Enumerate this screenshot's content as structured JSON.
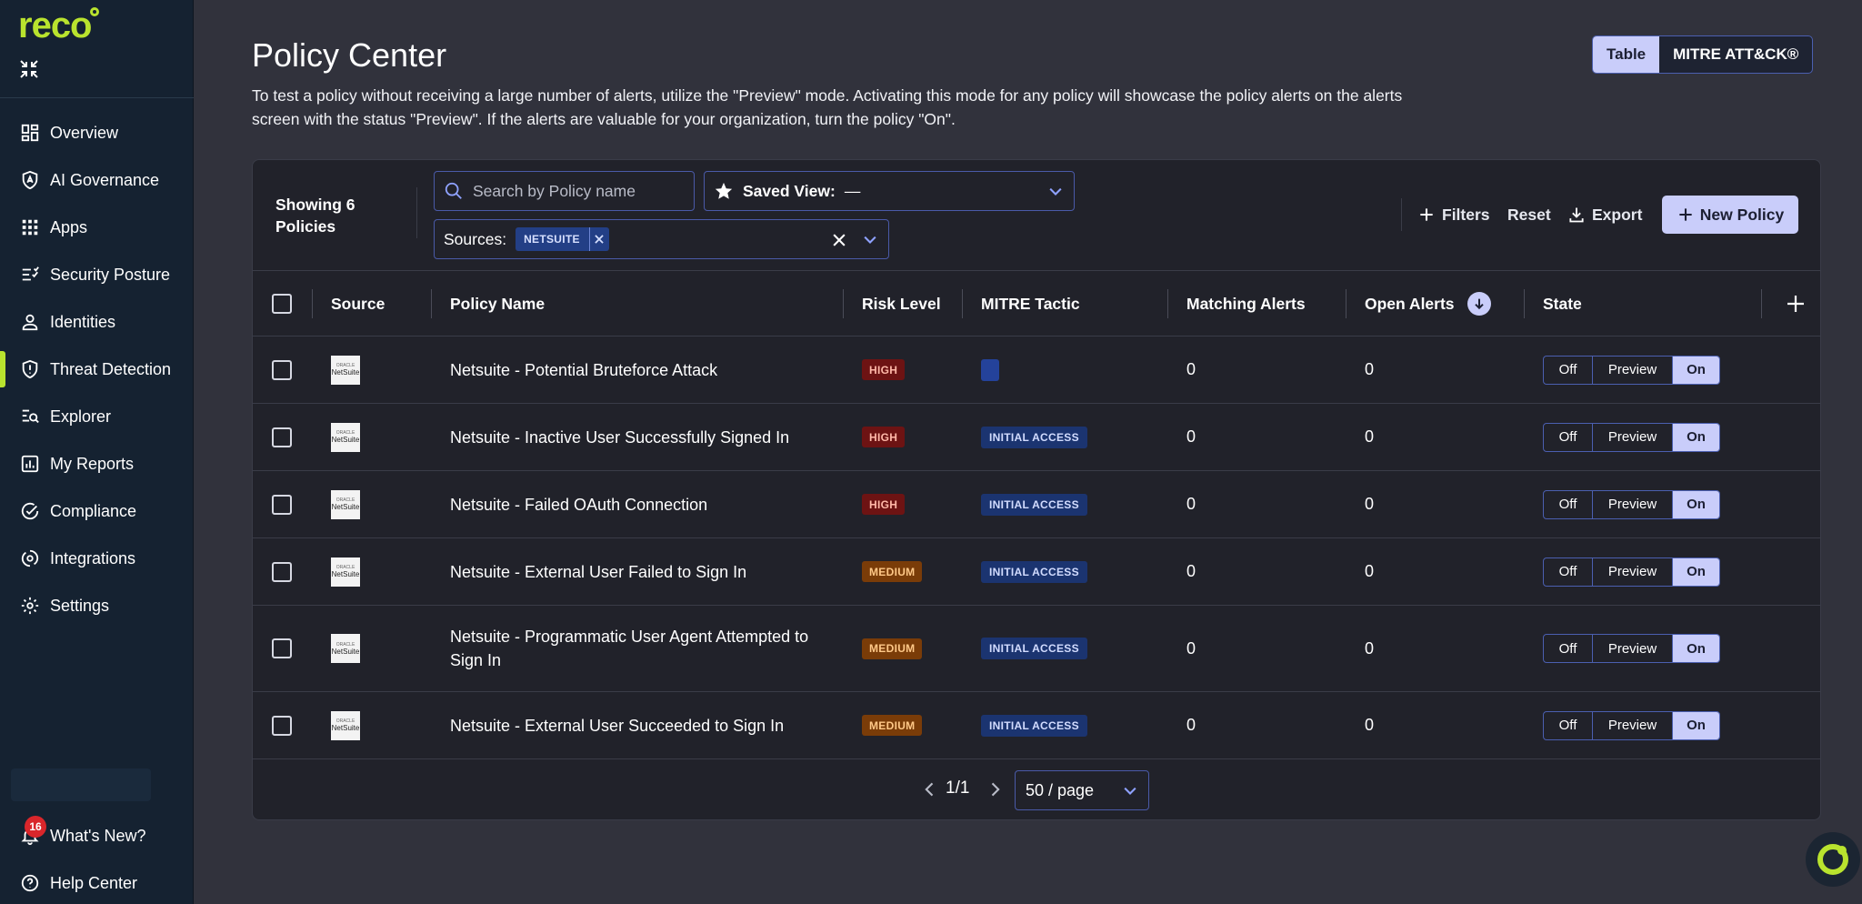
{
  "brand": {
    "logo_text": "reco",
    "accent": "#b9e32e"
  },
  "sidebar": {
    "items": [
      {
        "label": "Overview",
        "icon": "dashboard-icon"
      },
      {
        "label": "AI Governance",
        "icon": "ai-shield-icon"
      },
      {
        "label": "Apps",
        "icon": "grid-icon"
      },
      {
        "label": "Security Posture",
        "icon": "checklist-icon"
      },
      {
        "label": "Identities",
        "icon": "person-icon"
      },
      {
        "label": "Threat Detection",
        "icon": "shield-icon",
        "active": true
      },
      {
        "label": "Explorer",
        "icon": "search-list-icon"
      },
      {
        "label": "My Reports",
        "icon": "report-icon"
      },
      {
        "label": "Compliance",
        "icon": "check-circle-icon"
      },
      {
        "label": "Integrations",
        "icon": "integrations-icon"
      },
      {
        "label": "Settings",
        "icon": "gear-icon"
      }
    ],
    "whats_new": {
      "label": "What's New?",
      "count": "16"
    },
    "help_center": "Help Center"
  },
  "header": {
    "title": "Policy Center",
    "description": "To test a policy without receiving a large number of alerts, utilize the \"Preview\" mode. Activating this mode for any policy will showcase the policy alerts on the alerts screen with the status \"Preview\". If the alerts are valuable for your organization, turn the policy \"On\".",
    "view_toggle": {
      "table": "Table",
      "mitre": "MITRE ATT&CK®",
      "selected": "Table"
    }
  },
  "toolbar": {
    "showing": "Showing 6 Policies",
    "search_placeholder": "Search by Policy name",
    "saved_view_label": "Saved View:",
    "saved_view_value": "—",
    "sources_label": "Sources:",
    "sources_chip": "NETSUITE",
    "filters": "Filters",
    "reset": "Reset",
    "export": "Export",
    "new_policy": "New Policy"
  },
  "table": {
    "columns": {
      "source": "Source",
      "policy_name": "Policy Name",
      "risk_level": "Risk Level",
      "mitre_tactic": "MITRE Tactic",
      "matching_alerts": "Matching Alerts",
      "open_alerts": "Open Alerts",
      "state": "State"
    },
    "source_logo": {
      "top": "ORACLE",
      "bottom": "NetSuite"
    },
    "state_options": {
      "off": "Off",
      "preview": "Preview",
      "on": "On"
    },
    "rows": [
      {
        "name": "Netsuite - Potential Bruteforce Attack",
        "risk": "HIGH",
        "mitre": "",
        "matching": "0",
        "open": "0",
        "state": "On"
      },
      {
        "name": "Netsuite - Inactive User Successfully Signed In",
        "risk": "HIGH",
        "mitre": "INITIAL ACCESS",
        "matching": "0",
        "open": "0",
        "state": "On"
      },
      {
        "name": "Netsuite - Failed OAuth Connection",
        "risk": "HIGH",
        "mitre": "INITIAL ACCESS",
        "matching": "0",
        "open": "0",
        "state": "On"
      },
      {
        "name": "Netsuite - External User Failed to Sign In",
        "risk": "MEDIUM",
        "mitre": "INITIAL ACCESS",
        "matching": "0",
        "open": "0",
        "state": "On"
      },
      {
        "name": "Netsuite - Programmatic User Agent Attempted to Sign In",
        "risk": "MEDIUM",
        "mitre": "INITIAL ACCESS",
        "matching": "0",
        "open": "0",
        "state": "On"
      },
      {
        "name": "Netsuite - External User Succeeded to Sign In",
        "risk": "MEDIUM",
        "mitre": "INITIAL ACCESS",
        "matching": "0",
        "open": "0",
        "state": "On"
      }
    ]
  },
  "pagination": {
    "page": "1/1",
    "page_size": "50 / page"
  }
}
